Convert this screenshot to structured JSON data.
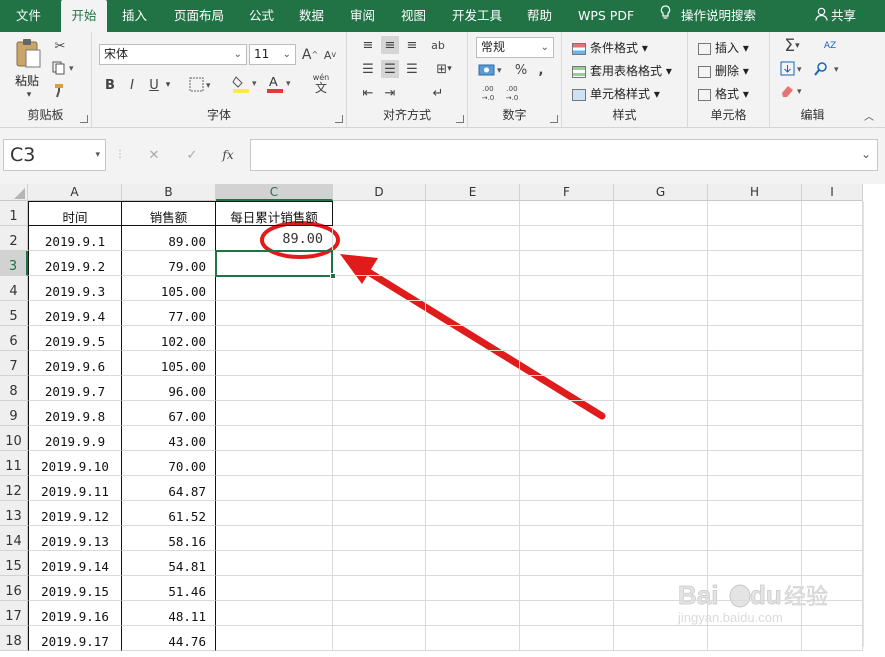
{
  "tabs": [
    "文件",
    "开始",
    "插入",
    "页面布局",
    "公式",
    "数据",
    "审阅",
    "视图",
    "开发工具",
    "帮助",
    "WPS PDF"
  ],
  "tell_me": "操作说明搜索",
  "share": "共享",
  "ribbon": {
    "paste": "粘贴",
    "groups": {
      "clipboard": "剪贴板",
      "font": "字体",
      "alignment": "对齐方式",
      "number": "数字",
      "styles": "样式",
      "cells": "单元格",
      "editing": "编辑"
    },
    "font_name": "宋体",
    "font_size": "11",
    "font_btns": [
      "B",
      "I",
      "U"
    ],
    "grow": "A",
    "shrink": "A",
    "wen": "wén",
    "wen2": "文",
    "number_format": "常规",
    "percent": "%",
    "comma": ",",
    "dec_inc": ".00",
    "dec_inc2": "→.0",
    "dec_dec": ".00",
    "dec_dec2": "→.0",
    "styles": [
      "条件格式",
      "套用表格格式",
      "单元格样式"
    ],
    "cells": [
      "插入",
      "删除",
      "格式"
    ],
    "sigma": "Σ",
    "sort": "AZ"
  },
  "formula_bar": {
    "name_box": "C3",
    "cancel": "✕",
    "enter": "✓",
    "fx": "fx",
    "formula": ""
  },
  "columns": [
    "A",
    "B",
    "C",
    "D",
    "E",
    "F",
    "G",
    "H",
    "I"
  ],
  "rows": [
    "1",
    "2",
    "3",
    "4",
    "5",
    "6",
    "7",
    "8",
    "9",
    "10",
    "11",
    "12",
    "13",
    "14",
    "15",
    "16",
    "17",
    "18"
  ],
  "table": {
    "headers": [
      "时间",
      "销售额",
      "每日累计销售额"
    ],
    "data": [
      [
        "2019.9.1",
        "89.00",
        "89.00"
      ],
      [
        "2019.9.2",
        "79.00",
        ""
      ],
      [
        "2019.9.3",
        "105.00",
        ""
      ],
      [
        "2019.9.4",
        "77.00",
        ""
      ],
      [
        "2019.9.5",
        "102.00",
        ""
      ],
      [
        "2019.9.6",
        "105.00",
        ""
      ],
      [
        "2019.9.7",
        "96.00",
        ""
      ],
      [
        "2019.9.8",
        "67.00",
        ""
      ],
      [
        "2019.9.9",
        "43.00",
        ""
      ],
      [
        "2019.9.10",
        "70.00",
        ""
      ],
      [
        "2019.9.11",
        "64.87",
        ""
      ],
      [
        "2019.9.12",
        "61.52",
        ""
      ],
      [
        "2019.9.13",
        "58.16",
        ""
      ],
      [
        "2019.9.14",
        "54.81",
        ""
      ],
      [
        "2019.9.15",
        "51.46",
        ""
      ],
      [
        "2019.9.16",
        "48.11",
        ""
      ],
      [
        "2019.9.17",
        "44.76",
        ""
      ]
    ]
  },
  "selected_cell": "C3",
  "watermark": "Baidu经验 jingyan.baidu.com",
  "colors": {
    "excel_green": "#217346",
    "annotation_red": "#e01b1b"
  }
}
